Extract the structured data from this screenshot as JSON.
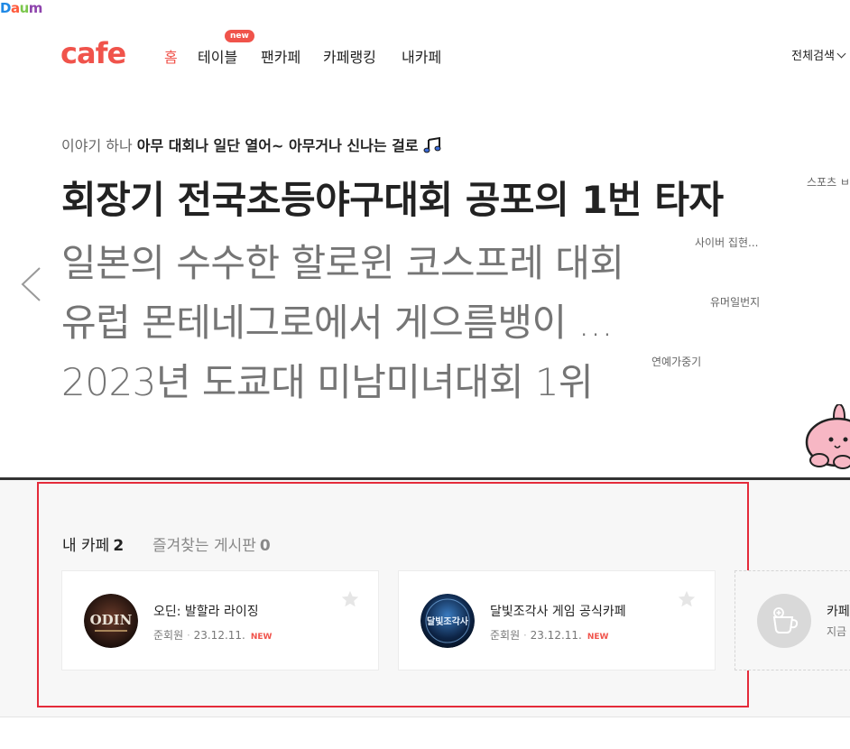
{
  "daum_logo": {
    "d": "D",
    "a": "a",
    "u": "u",
    "m": "m"
  },
  "cafe_logo": "cafe",
  "nav": {
    "home": "홈",
    "table": "테이블",
    "table_badge": "new",
    "fancafe": "팬카페",
    "ranking": "카페랭킹",
    "mycafe": "내카페"
  },
  "search_all": "전체검색",
  "hero": {
    "subtitle_prefix": "이야기 하나",
    "subtitle_bold": "아무 대회나 일단 열어~ 아무거나 신나는 걸로",
    "headlines": [
      {
        "text": "회장기 전국초등야구대회 공포의 1번 타자",
        "tag": "스포츠 ㅂ"
      },
      {
        "text": "일본의 수수한 할로윈 코스프레 대회",
        "tag": "사이버 집현..."
      },
      {
        "text": "유럽 몬테네그로에서 게으름뱅이 ...",
        "tag": "유머일번지"
      },
      {
        "text": "2023년 도쿄대 미남미녀대회 1위",
        "tag": "연예가중기"
      }
    ]
  },
  "mycafe_section": {
    "my_label": "내 카페",
    "my_count": "2",
    "fav_label": "즐겨찾는 게시판",
    "fav_count": "0",
    "cards": [
      {
        "name": "오딘: 발할라 라이징",
        "role": "준회원",
        "date": "23.12.11.",
        "badge": "NEW",
        "logo_text": "ODIN"
      },
      {
        "name": "달빛조각사 게임 공식카페",
        "role": "준회원",
        "date": "23.12.11.",
        "badge": "NEW",
        "logo_text": "달빛조각사"
      }
    ],
    "add_card": {
      "name": "카페",
      "meta": "지금"
    }
  },
  "icons": [
    "music-note-icon",
    "prev-arrow-icon",
    "star-icon",
    "cup-icon",
    "chevron-down-icon"
  ]
}
